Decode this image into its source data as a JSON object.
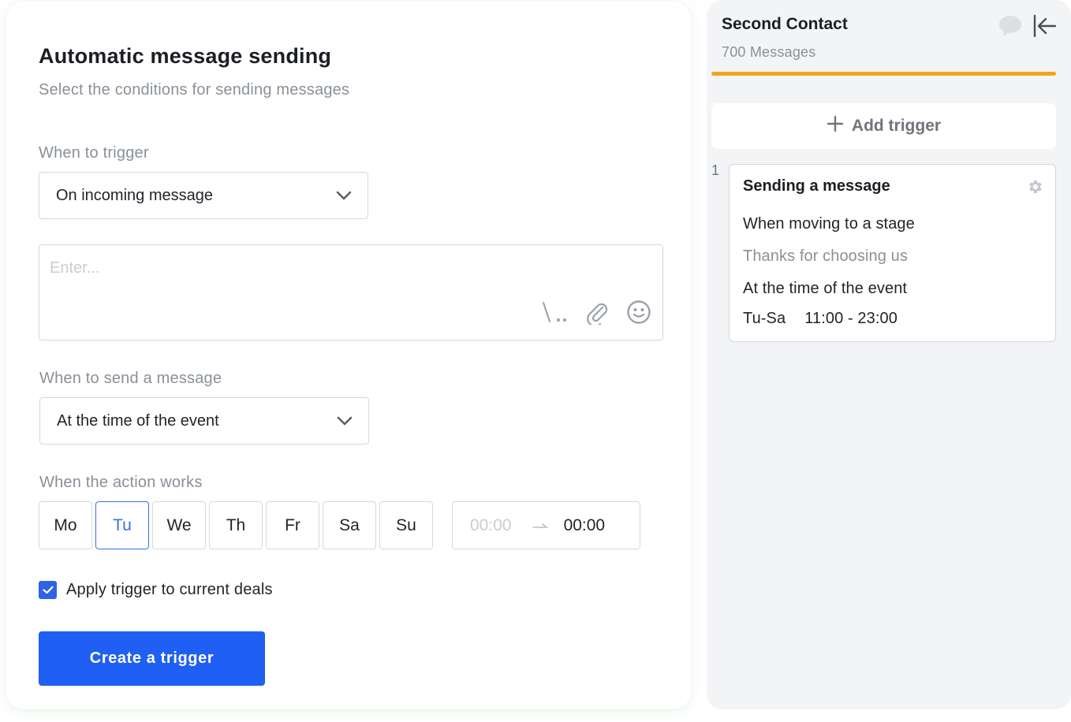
{
  "form": {
    "title": "Automatic message sending",
    "subtitle": "Select the conditions for sending messages",
    "when_to_trigger_label": "When to trigger",
    "trigger_select_value": "On incoming message",
    "message_placeholder": "Enter...",
    "when_to_send_label": "When to send a message",
    "send_select_value": "At the time of the event",
    "when_action_works_label": "When the action works",
    "days": [
      "Mo",
      "Tu",
      "We",
      "Th",
      "Fr",
      "Sa",
      "Su"
    ],
    "selected_day": "Tu",
    "time_from": "00:00",
    "time_to": "00:00",
    "apply_checkbox_label": "Apply trigger to current deals",
    "apply_checked": true,
    "create_button_label": "Create a trigger"
  },
  "panel": {
    "title": "Second Contact",
    "subtitle": "700 Messages",
    "progress_color": "#f0a61c",
    "add_trigger_label": "Add trigger",
    "trigger_index": "1",
    "trigger_card": {
      "title": "Sending a message",
      "condition": "When moving to a stage",
      "message_preview": "Thanks for choosing us",
      "timing": "At the time of the event",
      "days": "Tu-Sa",
      "hours": "11:00 - 23:00"
    }
  },
  "colors": {
    "accent": "#1f5ff3",
    "selected_day": "#3a6fe8",
    "muted_text": "#8a9099"
  },
  "icons": [
    "chevron-down-icon",
    "signature-icon",
    "paperclip-icon",
    "smiley-icon",
    "check-icon",
    "chat-bubble-icon",
    "collapse-arrow-icon",
    "plus-icon",
    "gear-icon"
  ]
}
